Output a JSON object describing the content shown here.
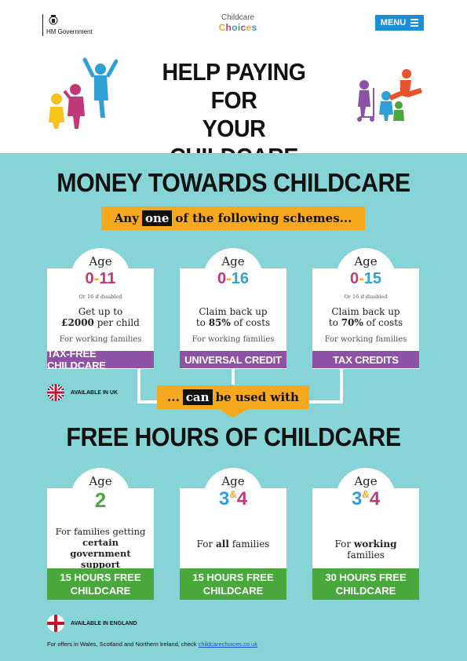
{
  "header": {
    "gov_label": "HM Government",
    "brand_top": "Childcare",
    "brand_bottom": "Choices",
    "menu_label": "MENU",
    "title_line1": "HELP PAYING FOR",
    "title_line2": "YOUR CHILDCARE"
  },
  "money": {
    "title": "MONEY TOWARDS CHILDCARE",
    "banner_pre": "Any",
    "banner_hl": "one",
    "banner_post": "of the following schemes...",
    "cards": [
      {
        "age_label": "Age",
        "age_range": "0-11",
        "note": "Or 16 if disabled",
        "desc_line1": "Get up to",
        "desc_bold": "£2000",
        "desc_line2_rest": " per child",
        "for": "For working families",
        "scheme": "TAX-FREE CHILDCARE"
      },
      {
        "age_label": "Age",
        "age_range": "0-16",
        "note": "",
        "desc_line1": "Claim back up",
        "desc_pre": "to ",
        "desc_bold": "85%",
        "desc_post": " of costs",
        "for": "For working families",
        "scheme": "UNIVERSAL CREDIT"
      },
      {
        "age_label": "Age",
        "age_range": "0-15",
        "note": "Or 16 if disabled",
        "desc_line1": "Claim back up",
        "desc_pre": "to ",
        "desc_bold": "70%",
        "desc_post": " of costs",
        "for": "For working families",
        "scheme": "TAX CREDITS"
      }
    ],
    "available": "AVAILABLE IN UK"
  },
  "join": {
    "pre": "...",
    "hl": "can",
    "post": "be used with"
  },
  "free": {
    "title": "FREE HOURS OF CHILDCARE",
    "cards": [
      {
        "age_label": "Age",
        "age_range": "2",
        "desc_line1": "For families getting",
        "desc_bold": "certain government",
        "desc_bold2": "support",
        "bar_line1": "15 HOURS FREE",
        "bar_line2": "CHILDCARE"
      },
      {
        "age_label": "Age",
        "age_a": "3",
        "age_amp": "&",
        "age_b": "4",
        "desc_pre": "For ",
        "desc_bold": "all",
        "desc_post": " families",
        "bar_line1": "15 HOURS FREE",
        "bar_line2": "CHILDCARE"
      },
      {
        "age_label": "Age",
        "age_a": "3",
        "age_amp": "&",
        "age_b": "4",
        "desc_pre": "For ",
        "desc_bold": "working",
        "desc_post": " families",
        "bar_line1": "30 HOURS FREE",
        "bar_line2": "CHILDCARE"
      }
    ],
    "available": "AVAILABLE IN ENGLAND"
  },
  "footer": {
    "text": "For offers in Wales, Scotland and Northern Ireland, check ",
    "link": "childcarechoices.co.uk"
  },
  "colors": {
    "teal": "#87d4d7",
    "orange": "#f6a81e",
    "purple": "#8e52a5",
    "green": "#48a83b",
    "menu_blue": "#1d8ed6",
    "age_pink": "#c03a7a",
    "age_blue": "#2f9fd8",
    "age_green": "#4aa83f"
  }
}
